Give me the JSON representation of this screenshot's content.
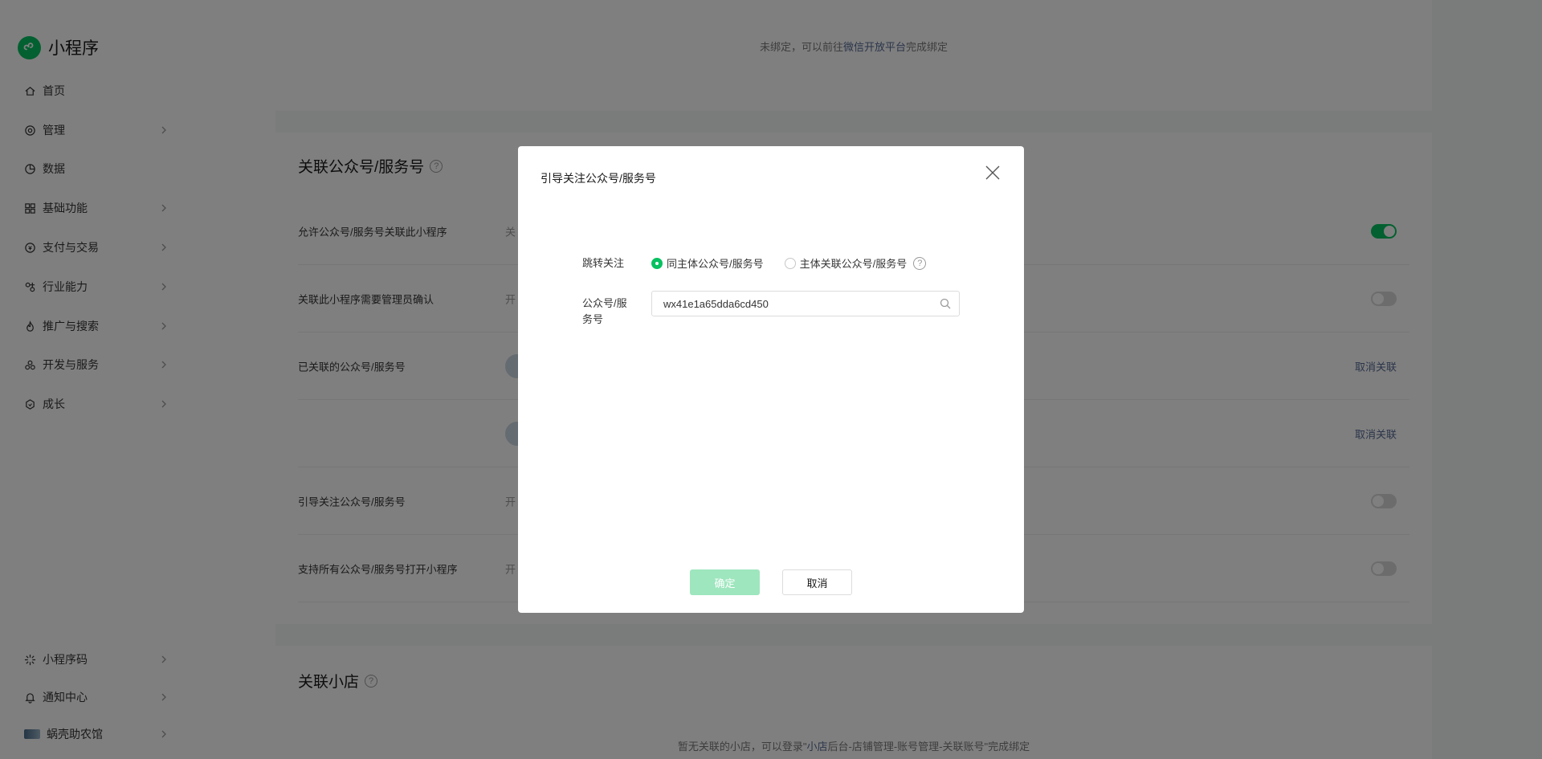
{
  "app": {
    "logo_text": "小程序",
    "brand_color": "#07c160",
    "link_color": "#576b95"
  },
  "sidebar": {
    "items": [
      {
        "label": "首页",
        "icon": "home-icon",
        "has_chevron": false
      },
      {
        "label": "管理",
        "icon": "settings-icon",
        "has_chevron": true
      },
      {
        "label": "数据",
        "icon": "chart-pie-icon",
        "has_chevron": false
      },
      {
        "label": "基础功能",
        "icon": "grid-icon",
        "has_chevron": true
      },
      {
        "label": "支付与交易",
        "icon": "payment-icon",
        "has_chevron": true
      },
      {
        "label": "行业能力",
        "icon": "industry-icon",
        "has_chevron": true
      },
      {
        "label": "推广与搜索",
        "icon": "flame-icon",
        "has_chevron": true
      },
      {
        "label": "开发与服务",
        "icon": "dev-icon",
        "has_chevron": true
      },
      {
        "label": "成长",
        "icon": "growth-icon",
        "has_chevron": true
      }
    ],
    "bottom_items": [
      {
        "label": "小程序码",
        "icon": "qrcode-icon",
        "has_chevron": true
      },
      {
        "label": "通知中心",
        "icon": "bell-icon",
        "has_chevron": true
      },
      {
        "label": "蜗壳助农馆",
        "icon": "account-avatar",
        "has_chevron": true
      }
    ]
  },
  "main": {
    "unbound_prefix": "未绑定，可以前往",
    "unbound_link": "微信开放平台",
    "unbound_suffix": "完成绑定",
    "mp_section": {
      "title": "关联公众号/服务号",
      "rows": [
        {
          "label": "允许公众号/服务号关联此小程序",
          "value": "关",
          "control": "toggle",
          "on": true
        },
        {
          "label": "关联此小程序需要管理员确认",
          "value": "开",
          "control": "toggle",
          "on": false
        },
        {
          "label": "已关联的公众号/服务号",
          "value": "",
          "control": "unlink",
          "action": "取消关联"
        },
        {
          "label": "",
          "value": "",
          "control": "unlink",
          "action": "取消关联"
        },
        {
          "label": "引导关注公众号/服务号",
          "value": "开",
          "control": "toggle",
          "on": false
        },
        {
          "label": "支持所有公众号/服务号打开小程序",
          "value": "开",
          "control": "toggle",
          "on": false
        }
      ]
    },
    "shop_section": {
      "title": "关联小店",
      "empty_prefix": "暂无关联的小店，可以登录\"",
      "empty_link": "小店",
      "empty_suffix": "后台-店铺管理-账号管理-关联账号\"完成绑定"
    }
  },
  "modal": {
    "title": "引导关注公众号/服务号",
    "jump_label": "跳转关注",
    "radio_options": [
      {
        "label": "同主体公众号/服务号",
        "checked": true
      },
      {
        "label": "主体关联公众号/服务号",
        "checked": false
      }
    ],
    "account_label_line1": "公众号/服",
    "account_label_line2": "务号",
    "account_value": "wx41e1a65dda6cd450",
    "confirm_label": "确定",
    "cancel_label": "取消"
  }
}
